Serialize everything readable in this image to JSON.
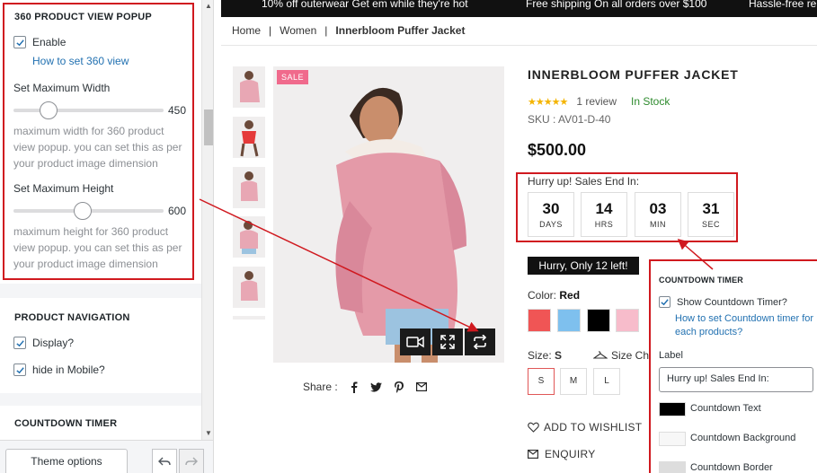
{
  "sidebar": {
    "popup_section": {
      "title": "360 PRODUCT VIEW POPUP",
      "enable_label": "Enable",
      "help_link": "How to set 360 view",
      "max_width": {
        "label": "Set Maximum Width",
        "value": "450",
        "slider_fraction": 0.22,
        "desc": [
          "maximum width for 360 product",
          "view popup. you can set this as per",
          "your product image dimension"
        ]
      },
      "max_height": {
        "label": "Set Maximum Height",
        "value": "600",
        "slider_fraction": 0.45,
        "desc": [
          "maximum height for 360 product",
          "view popup. you can set this as per",
          "your product image dimension"
        ]
      }
    },
    "nav_section": {
      "title": "PRODUCT NAVIGATION",
      "display_label": "Display?",
      "hide_mobile_label": "hide in Mobile?"
    },
    "countdown_section": {
      "title": "COUNTDOWN TIMER"
    },
    "footer": {
      "theme_options": "Theme options"
    }
  },
  "store": {
    "announcements": [
      "10% off outerwear Get em while they're hot",
      "Free shipping On all orders over $100",
      "Hassle-free re"
    ],
    "breadcrumb": [
      "Home",
      "Women",
      "Innerbloom Puffer Jacket"
    ],
    "sale_badge": "SALE",
    "product": {
      "title": "INNERBLOOM PUFFER JACKET",
      "rating_stars": 5,
      "review_text": "1 review",
      "stock": "In Stock",
      "sku": "SKU : AV01-D-40",
      "price": "$500.00",
      "hurry_label": "Hurry up! Sales End In:",
      "countdown": [
        {
          "value": "30",
          "unit": "DAYS"
        },
        {
          "value": "14",
          "unit": "HRS"
        },
        {
          "value": "03",
          "unit": "MIN"
        },
        {
          "value": "31",
          "unit": "SEC"
        }
      ],
      "stock_bar": "Hurry, Only 12 left!",
      "color_label": "Color:",
      "color_value": "Red",
      "colors": [
        "#f05555",
        "#7ec0ee",
        "#000000",
        "#f7bccb"
      ],
      "size_label": "Size:",
      "size_value": "S",
      "size_chart": "Size Char",
      "sizes": [
        "S",
        "M",
        "L"
      ],
      "wishlist": "ADD TO WISHLIST",
      "enquiry": "ENQUIRY",
      "share": "Share :"
    }
  },
  "countdown_panel": {
    "title": "COUNTDOWN TIMER",
    "show_label": "Show Countdown Timer?",
    "help_link": "How to set Countdown timer for each products?",
    "label_caption": "Label",
    "label_value": "Hurry up! Sales End In:",
    "swatches": [
      {
        "label": "Countdown Text",
        "color": "#000000"
      },
      {
        "label": "Countdown Background",
        "color": "#f7f7f7"
      },
      {
        "label": "Countdown Border",
        "color": "#dddddd"
      }
    ]
  },
  "colors": {
    "accent_red": "#d0191f",
    "link_blue": "#2271b1",
    "stock_green": "#2e8b2e",
    "star": "#f4b400"
  }
}
